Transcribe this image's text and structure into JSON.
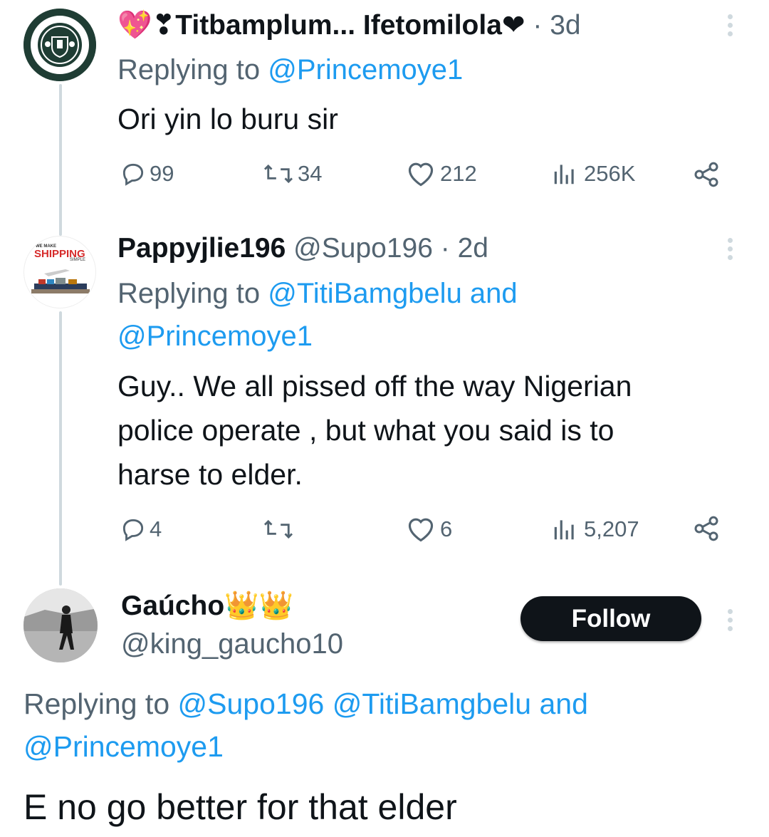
{
  "tweets": [
    {
      "display_name": "💖❣Titbamplum... Ifetomilola❤",
      "time": "· 3d",
      "replying_prefix": "Replying to",
      "replying_to": "@Princemoye1",
      "text": "Ori yin lo buru sir",
      "replies": "99",
      "retweets": "34",
      "likes": "212",
      "views": "256K",
      "avatar": "manchester-united-crest"
    },
    {
      "display_name": "Pappyjlie196",
      "handle": "@Supo196",
      "time": "· 2d",
      "replying_prefix": "Replying to",
      "replying_to_line1": "@TitiBamgbelu and",
      "replying_to_line2": "@Princemoye1",
      "text_lines": [
        "Guy.. We all pissed off the way Nigerian",
        "police operate , but what you said is to",
        "harse to elder."
      ],
      "replies": "4",
      "retweets": "",
      "likes": "6",
      "views": "5,207",
      "avatar": "shipping-logo",
      "avatar_text_small": "WE MAKE",
      "avatar_text_main": "SHIPPING",
      "avatar_text_sub": "SIMPLE"
    },
    {
      "display_name": "Gaúcho👑👑",
      "handle": "@king_gaucho10",
      "follow_label": "Follow",
      "replying_prefix": "Replying to",
      "replying_to_line1": "@Supo196 @TitiBamgbelu and",
      "replying_to_line2": "@Princemoye1",
      "text": "E no go better for that elder",
      "avatar": "man-walking-photo"
    }
  ],
  "colors": {
    "text": "#0f1419",
    "muted": "#536471",
    "link": "#1d9bf0",
    "thread_line": "#cfd9de",
    "button": "#0f1419"
  },
  "icons": [
    "reply-icon",
    "retweet-icon",
    "like-icon",
    "views-icon",
    "share-icon",
    "more-icon"
  ]
}
